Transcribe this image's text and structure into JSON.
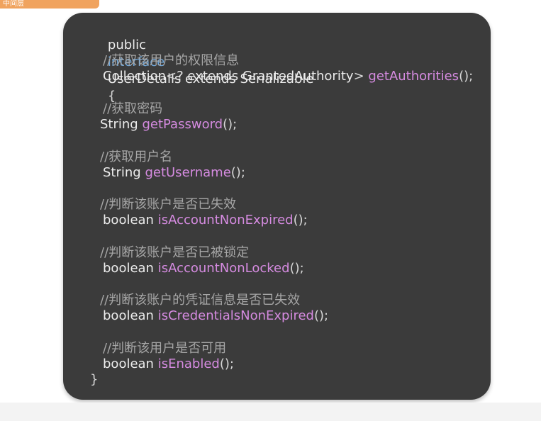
{
  "badge": {
    "label": "中间层"
  },
  "code": {
    "decl_public": "public",
    "decl_interface": "interface",
    "decl_rest": "UserDetails extends Serializable",
    "decl_brace": "{",
    "c1": "//获取该用户的权限信息",
    "m1_type_a": "Collection",
    "m1_lt": "<",
    "m1_type_b": "? extends GrantedAuthority",
    "m1_gt": ">",
    "m1_name": "getAuthorities",
    "m1_suffix": "();",
    "c2": "//获取密码",
    "m2_type": "String",
    "m2_name": "getPassword",
    "m2_suffix": "();",
    "c3": "//获取用户名",
    "m3_type": "String",
    "m3_name": "getUsername",
    "m3_suffix": "();",
    "c4": "//判断该账户是否已失效",
    "m4_type": "boolean",
    "m4_name": "isAccountNonExpired",
    "m4_suffix": "();",
    "c5": "//判断该账户是否已被锁定",
    "m5_type": "boolean",
    "m5_name": "isAccountNonLocked",
    "m5_suffix": "();",
    "c6": "//判断该账户的凭证信息是否已失效",
    "m6_type": "boolean",
    "m6_name": "isCredentialsNonExpired",
    "m6_suffix": "();",
    "c7": "//判断该用户是否可用",
    "m7_type": "boolean",
    "m7_name": "isEnabled",
    "m7_suffix": "();",
    "close_brace": "}"
  },
  "colors": {
    "card_bg": "#3b3b3b",
    "text": "#ececec",
    "comment": "#a6a6a6",
    "keyword": "#6fa8dc",
    "method": "#d58be0",
    "badge": "#f0a35e"
  }
}
